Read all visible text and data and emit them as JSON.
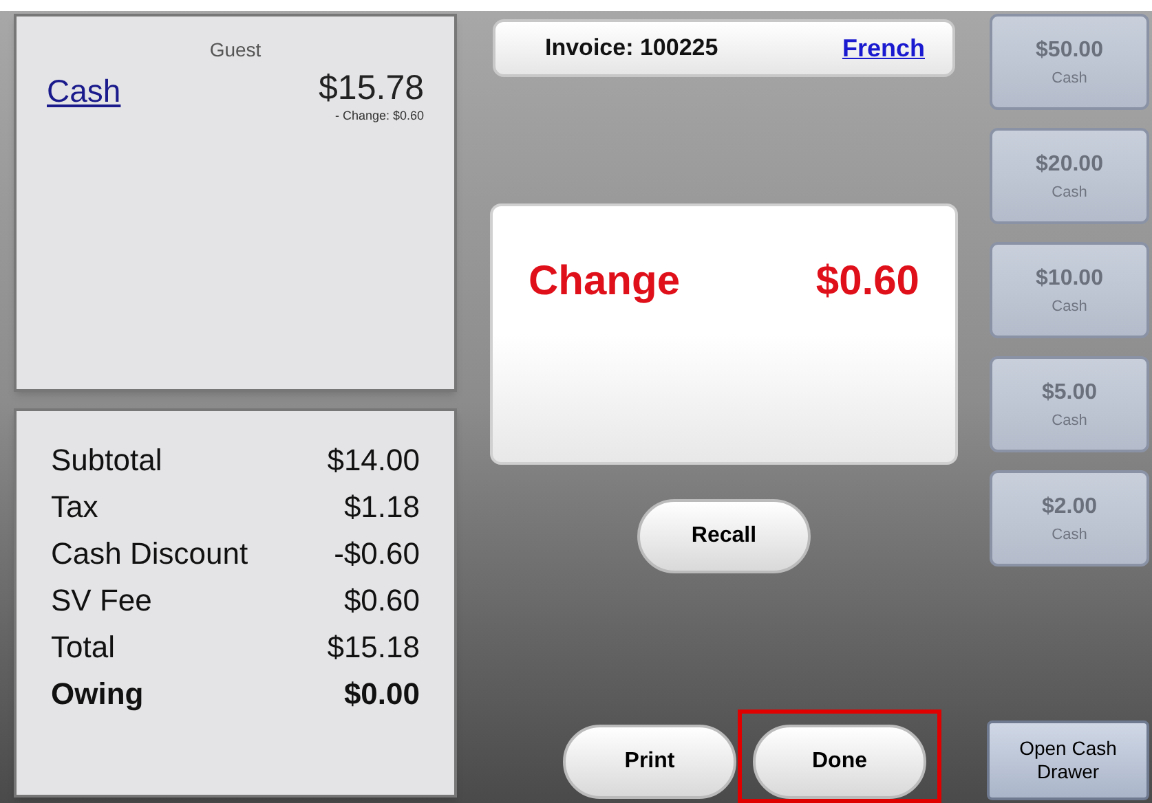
{
  "payment": {
    "header": "Guest",
    "tenders": [
      {
        "method": "Cash",
        "amount": "$15.78",
        "note": "- Change: $0.60"
      }
    ]
  },
  "totals": [
    {
      "label": "Subtotal",
      "value": "$14.00",
      "bold": false
    },
    {
      "label": "Tax",
      "value": "$1.18",
      "bold": false
    },
    {
      "label": "Cash Discount",
      "value": "-$0.60",
      "bold": false
    },
    {
      "label": "SV Fee",
      "value": "$0.60",
      "bold": false
    },
    {
      "label": "Total",
      "value": "$15.18",
      "bold": false
    },
    {
      "label": "Owing",
      "value": "$0.00",
      "bold": true
    }
  ],
  "invoice": {
    "label": "Invoice: 100225",
    "language_link": "French"
  },
  "change": {
    "label": "Change",
    "amount": "$0.60"
  },
  "recall_button": "Recall",
  "bottom_buttons": [
    {
      "label": "Print",
      "highlighted": false
    },
    {
      "label": "Done",
      "highlighted": true
    }
  ],
  "cash_buttons": [
    {
      "amount": "$50.00",
      "sub": "Cash",
      "disabled": true
    },
    {
      "amount": "$20.00",
      "sub": "Cash",
      "disabled": true
    },
    {
      "amount": "$10.00",
      "sub": "Cash",
      "disabled": true
    },
    {
      "amount": "$5.00",
      "sub": "Cash",
      "disabled": true
    },
    {
      "amount": "$2.00",
      "sub": "Cash",
      "disabled": true
    }
  ],
  "open_drawer_button": "Open Cash Drawer"
}
